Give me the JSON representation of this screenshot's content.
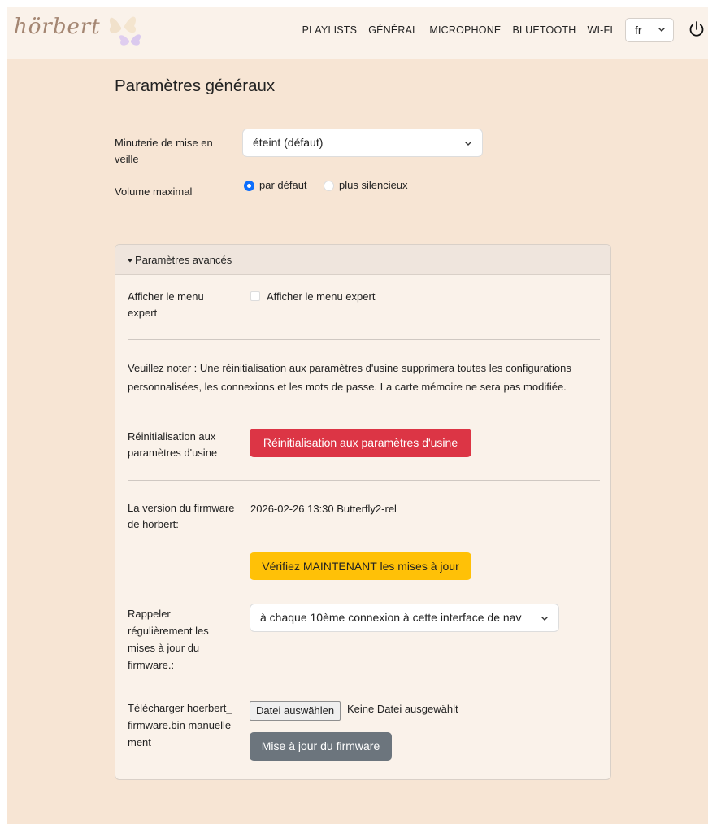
{
  "app": {
    "logo_text": "hörbert"
  },
  "nav": {
    "links": [
      "PLAYLISTS",
      "GÉNÉRAL",
      "MICROPHONE",
      "BLUETOOTH",
      "WI-FI"
    ],
    "language": "fr"
  },
  "general": {
    "title": "Paramètres généraux",
    "sleep_timer_label": "Minuterie de mise en veille",
    "sleep_timer_value": "éteint (défaut)",
    "max_volume_label": "Volume maximal",
    "volume_options": [
      "par défaut",
      "plus silencieux"
    ],
    "volume_selected": "par défaut"
  },
  "advanced": {
    "header": "Paramètres avancés",
    "expert_menu_label": "Afficher le menu expert",
    "expert_menu_checkbox_label": "Afficher le menu expert",
    "expert_menu_checked": false,
    "reset_note": "Veuillez noter : Une réinitialisation aux paramètres d'usine supprimera toutes les configurations personnalisées, les connexions et les mots de passe. La carte mémoire ne sera pas modifiée.",
    "reset_label": "Réinitialisation aux paramètres d'usine",
    "reset_button": "Réinitialisation aux paramètres d'usine",
    "firmware_version_label": "La version du firmware de hörbert:",
    "firmware_version_value": "2026-02-26 13:30 Butterfly2-rel",
    "check_updates_button": "Vérifiez MAINTENANT les mises à jour",
    "remind_label": "Rappeler régulièrement les mises à jour du firmware.:",
    "remind_value": "à chaque 10ème connexion à cette interface de nav",
    "upload_label": "Télécharger hoerbert_firmware.bin manuellement",
    "choose_file_button": "Datei auswählen",
    "no_file_text": "Keine Datei ausgewählt",
    "update_firmware_button": "Mise à jour du firmware"
  },
  "colors": {
    "page_bg": "#f7e5d4",
    "navbar_bg": "#faf2ea",
    "danger": "#dc3545",
    "warning": "#ffc107",
    "secondary": "#6c757d",
    "radio_checked": "#0d6efd"
  },
  "icons": {
    "lang_dropdown": "chevron-down-icon",
    "power": "power-icon",
    "collapse": "caret-down-icon"
  }
}
